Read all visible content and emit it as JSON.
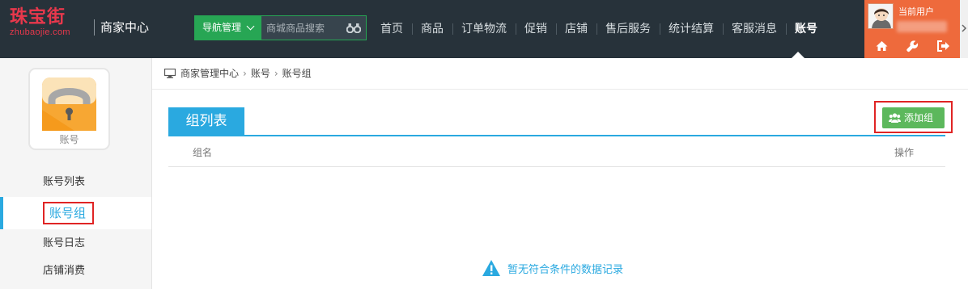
{
  "logo": {
    "cn": "珠宝街",
    "en": "zhubaojie.com"
  },
  "header": {
    "center_title": "商家中心",
    "nav_button": "导航管理",
    "search_placeholder": "商城商品搜索",
    "menu": [
      "首页",
      "商品",
      "订单物流",
      "促销",
      "店铺",
      "售后服务",
      "统计结算",
      "客服消息",
      "账号"
    ],
    "active_menu": "账号"
  },
  "user": {
    "label": "当前用户",
    "icons": [
      "home-icon",
      "wrench-icon",
      "logout-icon"
    ]
  },
  "sidebar": {
    "app_label": "账号",
    "items": [
      {
        "label": "账号列表",
        "active": false
      },
      {
        "label": "账号组",
        "active": true
      },
      {
        "label": "账号日志",
        "active": false
      },
      {
        "label": "店铺消费",
        "active": false
      }
    ]
  },
  "breadcrumb": [
    "商家管理中心",
    "账号",
    "账号组"
  ],
  "main": {
    "tab_title": "组列表",
    "add_button": "添加组",
    "columns": [
      "组名",
      "操作"
    ],
    "empty_message": "暂无符合条件的数据记录"
  },
  "colors": {
    "topbar": "#27323a",
    "accent": "#2aa9e0",
    "green": "#27a654",
    "orange": "#ee6a3c",
    "highlight": "#e02424"
  }
}
